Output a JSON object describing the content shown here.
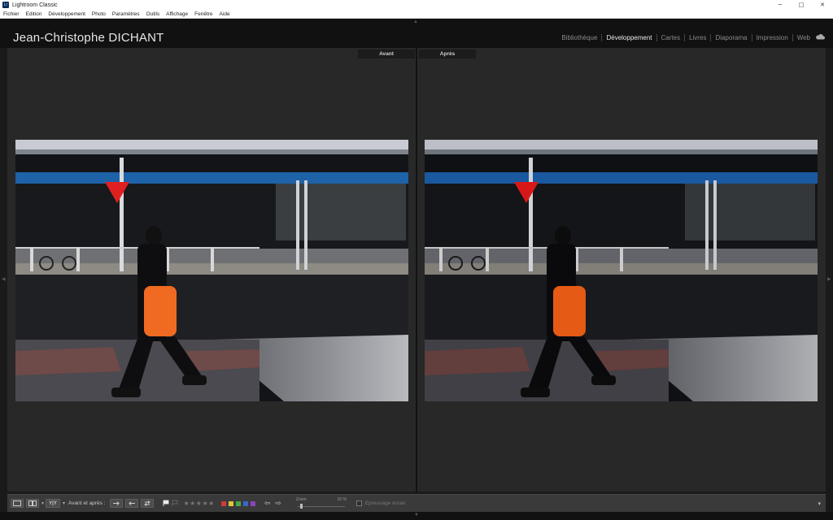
{
  "window": {
    "title": "Lightroom Classic",
    "app_icon": "Lr",
    "minimize": "─",
    "maximize": "□",
    "close": "✕"
  },
  "menu": [
    "Fichier",
    "Edition",
    "Développement",
    "Photo",
    "Paramètres",
    "Outils",
    "Affichage",
    "Fenêtre",
    "Aide"
  ],
  "identity_plate": "Jean-Christophe DICHANT",
  "modules": [
    {
      "label": "Bibliothèque",
      "active": false
    },
    {
      "label": "Développement",
      "active": true
    },
    {
      "label": "Cartes",
      "active": false
    },
    {
      "label": "Livres",
      "active": false
    },
    {
      "label": "Diaporama",
      "active": false
    },
    {
      "label": "Impression",
      "active": false
    },
    {
      "label": "Web",
      "active": false
    }
  ],
  "panes": {
    "before_label": "Avant",
    "after_label": "Après"
  },
  "toolbar": {
    "view_yy": "Y|Y",
    "before_after_label": "Avant et après :",
    "stars": "★★★★★",
    "color_labels": [
      "#d23a3a",
      "#d8c83a",
      "#46a844",
      "#3a66cc",
      "#8a46b8"
    ],
    "prev_arrow": "⇦",
    "next_arrow": "⇨",
    "zoom_label": "Zoom",
    "zoom_value": "16 %",
    "zoom_fraction": 0.05,
    "proof_label": "Epreuvage écran"
  },
  "colors": {
    "bag_before": "#f06a22",
    "bag_after": "#e55a14"
  }
}
